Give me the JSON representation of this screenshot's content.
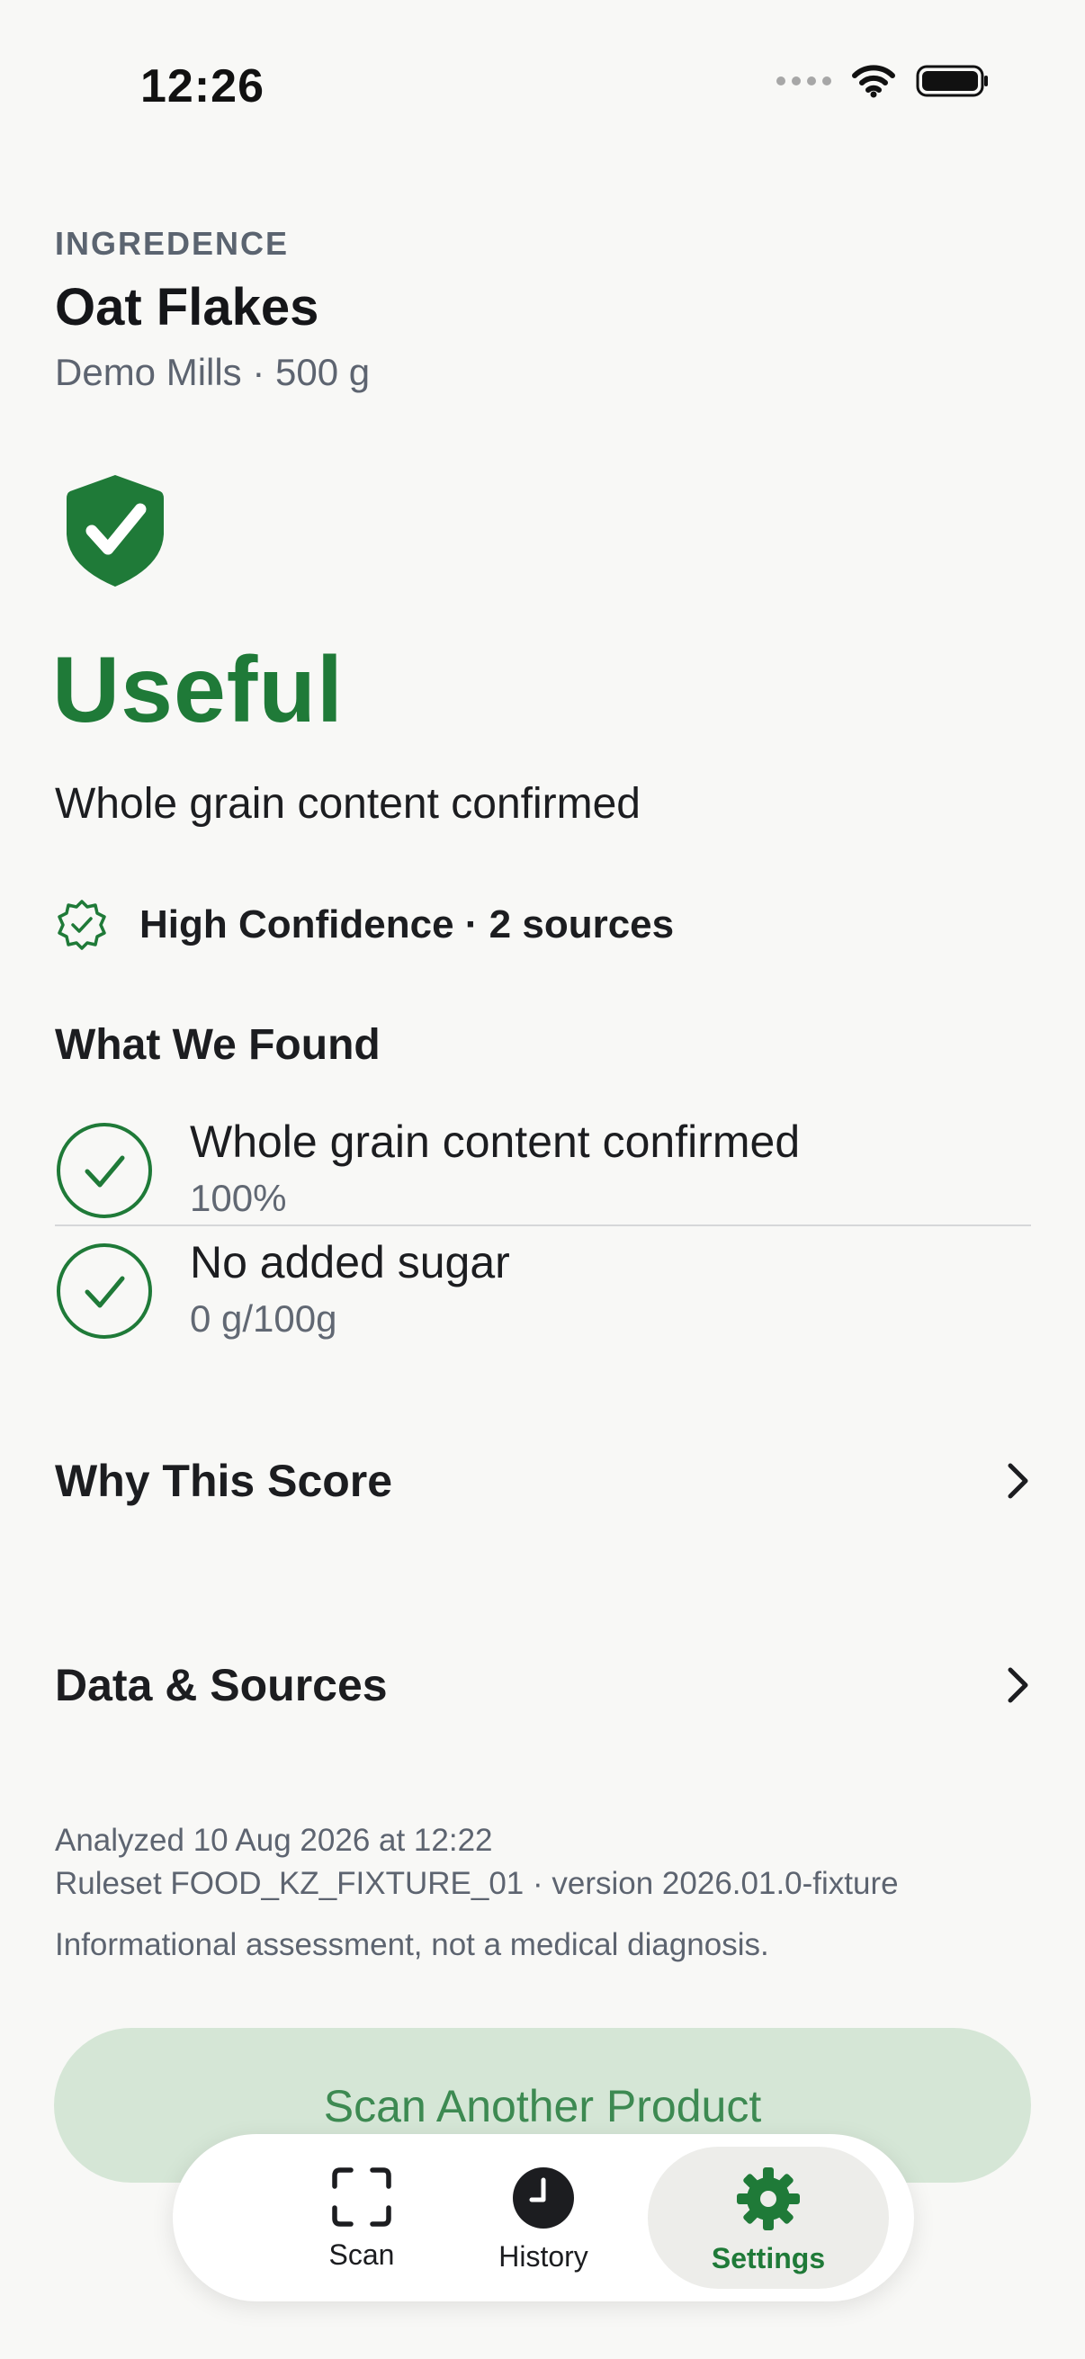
{
  "status_bar": {
    "time": "12:26"
  },
  "header": {
    "brand": "INGREDENCE",
    "product_name": "Oat Flakes",
    "product_meta": "Demo Mills · 500 g"
  },
  "verdict": {
    "label": "Useful",
    "summary": "Whole grain content confirmed",
    "color": "#1f7a38"
  },
  "confidence": {
    "text": "High Confidence · 2 sources"
  },
  "findings": {
    "title": "What We Found",
    "items": [
      {
        "title": "Whole grain content confirmed",
        "value": "100%"
      },
      {
        "title": "No added sugar",
        "value": "0 g/100g"
      }
    ]
  },
  "sections": {
    "why_score": "Why This Score",
    "data_sources": "Data & Sources"
  },
  "footer_meta": {
    "analyzed": "Analyzed 10 Aug 2026 at 12:22",
    "ruleset": "Ruleset FOOD_KZ_FIXTURE_01 · version 2026.01.0-fixture",
    "disclaimer": "Informational assessment, not a medical diagnosis."
  },
  "primary_action": {
    "label": "Scan Another Product"
  },
  "tabbar": {
    "tabs": [
      {
        "label": "Scan",
        "icon": "scan-frame-icon"
      },
      {
        "label": "History",
        "icon": "clock-icon"
      },
      {
        "label": "Settings",
        "icon": "gear-icon",
        "active": true
      }
    ]
  },
  "colors": {
    "accent": "#1f7a38",
    "background": "#f8f8f6",
    "button_bg": "#d5e6d6"
  }
}
